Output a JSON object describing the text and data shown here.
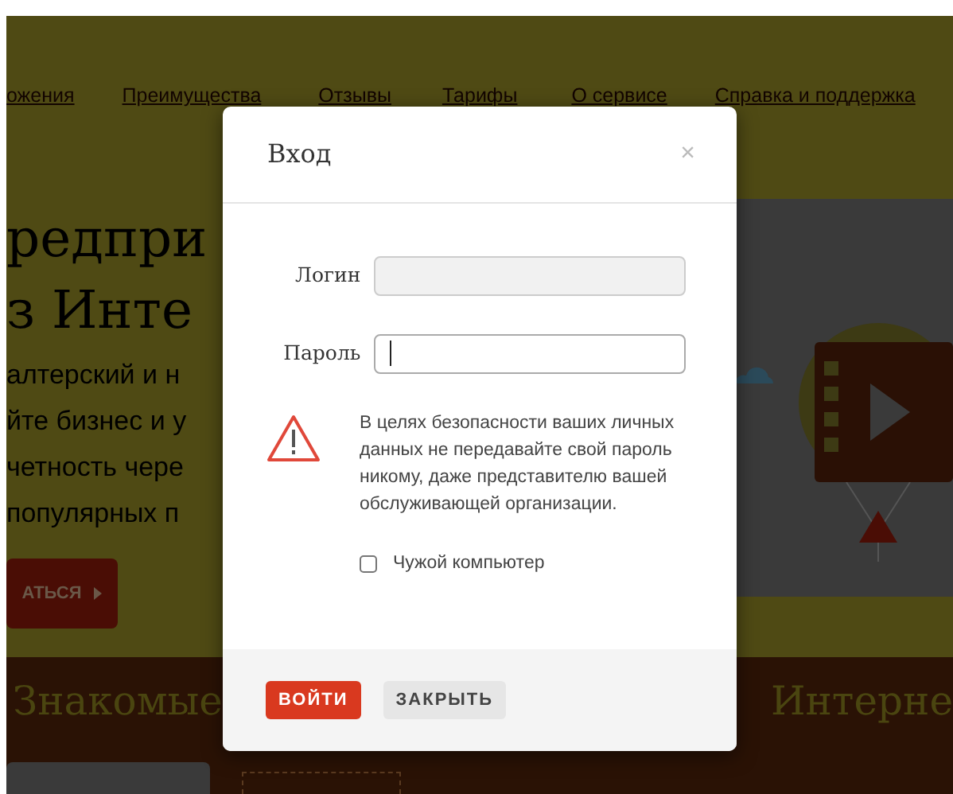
{
  "nav": {
    "links": [
      "ожения",
      "Преимущества",
      "Отзывы",
      "Тарифы",
      "О сервисе",
      "Справка и поддержка"
    ]
  },
  "hero": {
    "heading_lines": [
      "редпри",
      "з Инте"
    ],
    "text_lines": [
      "алтерский и н",
      "йте бизнес и у",
      "четность чере",
      "популярных п"
    ],
    "button": "АТЬСЯ"
  },
  "section": {
    "heading_left": "Знакомые",
    "heading_right": "Интерне"
  },
  "modal": {
    "title": "Вход",
    "close": "×",
    "fields": [
      {
        "label": "Логин",
        "focused": false
      },
      {
        "label": "Пароль",
        "focused": true
      }
    ],
    "warning": "В целях безопасности ваших личных данных не передавайте свой пароль никому, даже представителю вашей обслуживающей организации.",
    "checkbox": {
      "label": "Чужой компьютер",
      "checked": false
    },
    "buttons": [
      {
        "label": "ВОЙТИ",
        "kind": "primary"
      },
      {
        "label": "ЗАКРЫТЬ",
        "kind": "secondary"
      }
    ]
  }
}
